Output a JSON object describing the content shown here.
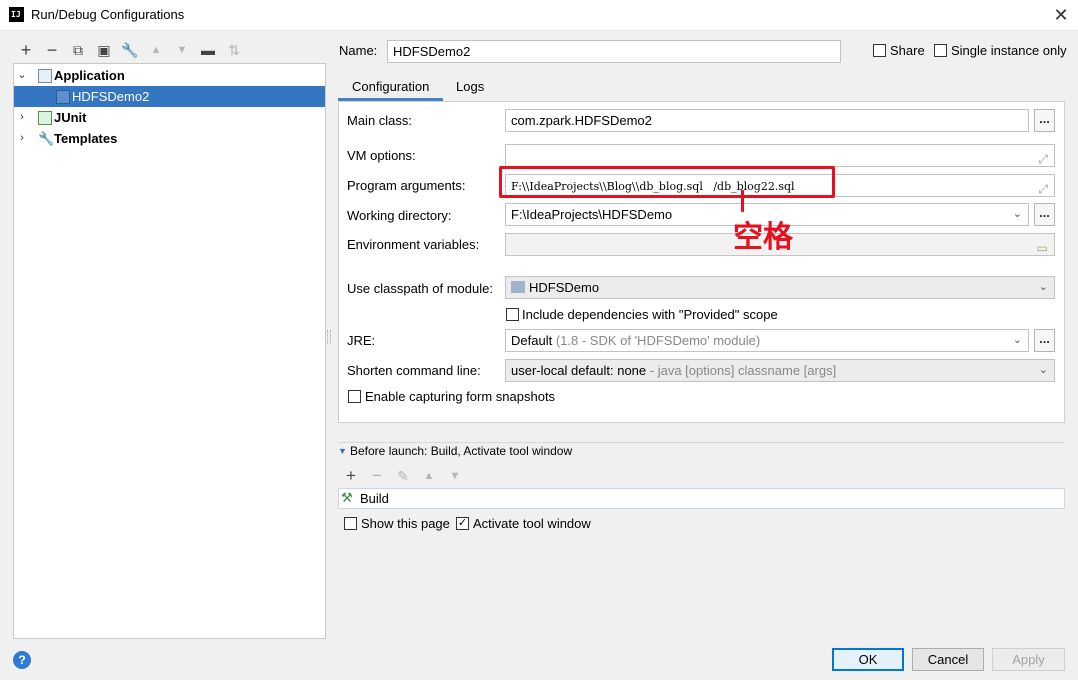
{
  "window": {
    "title": "Run/Debug Configurations",
    "app_icon": "IJ"
  },
  "toolbar": {
    "icons": [
      "add-icon",
      "remove-icon",
      "copy-icon",
      "save-icon",
      "wrench-icon",
      "move-up-icon",
      "move-down-icon",
      "folder-icon",
      "sort-icon"
    ]
  },
  "tree": {
    "application": "Application",
    "hdfsdemo2": "HDFSDemo2",
    "junit": "JUnit",
    "templates": "Templates"
  },
  "header": {
    "name_label": "Name:",
    "name_value": "HDFSDemo2",
    "share_label": "Share",
    "single_instance_label": "Single instance only"
  },
  "tabs": [
    "Configuration",
    "Logs"
  ],
  "form": {
    "main_class_label": "Main class:",
    "main_class_value": "com.zpark.HDFSDemo2",
    "vm_options_label": "VM options:",
    "vm_options_value": "",
    "program_args_label": "Program arguments:",
    "program_args_value": "F:\\\\IdeaProjects\\\\Blog\\\\db_blog.sql   /db_blog22.sql",
    "working_dir_label": "Working directory:",
    "working_dir_value": "F:\\IdeaProjects\\HDFSDemo",
    "env_vars_label": "Environment variables:",
    "env_vars_value": "",
    "classpath_label": "Use classpath of module:",
    "classpath_value": "HDFSDemo",
    "include_deps_label": "Include dependencies with \"Provided\" scope",
    "jre_label": "JRE:",
    "jre_value": "Default",
    "jre_hint": "(1.8 - SDK of 'HDFSDemo' module)",
    "shorten_label": "Shorten command line:",
    "shorten_value": "user-local default: none",
    "shorten_hint": "- java [options] classname [args]",
    "snapshots_label": "Enable capturing form snapshots",
    "dots": "..."
  },
  "annotation": {
    "text": "空格",
    "color": "#e8101e"
  },
  "before_launch": {
    "title": "Before launch: Build, Activate tool window",
    "task": "Build",
    "show_page_label": "Show this page",
    "show_page_checked": false,
    "activate_label": "Activate tool window",
    "activate_checked": true
  },
  "buttons": {
    "ok": "OK",
    "cancel": "Cancel",
    "apply": "Apply",
    "help": "?"
  },
  "colors": {
    "selection": "#3476c2",
    "accent": "#0078d7",
    "annotation": "#e8101e"
  }
}
